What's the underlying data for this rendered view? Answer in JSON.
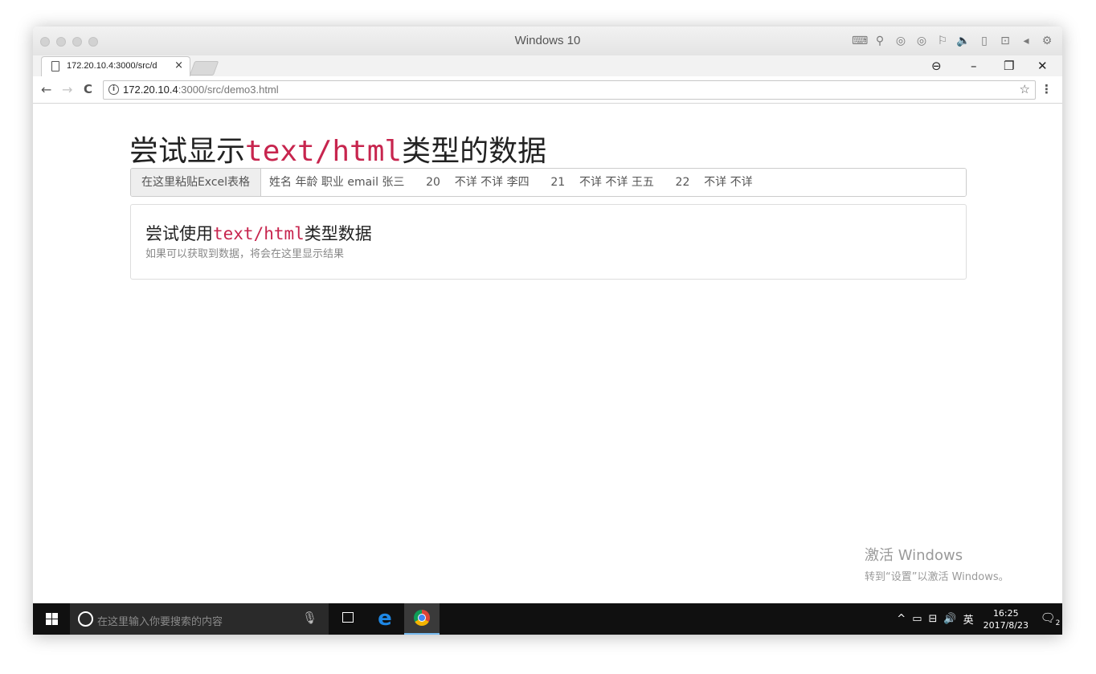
{
  "vm": {
    "title": "Windows 10",
    "tools": [
      "⌨",
      "⚲",
      "◎",
      "◎",
      "⚐",
      "🔈",
      "▯",
      "⊡",
      "◂",
      "⚙"
    ]
  },
  "browser": {
    "tab_title": "172.20.10.4:3000/src/d",
    "tab_close": "×",
    "url_host": "172.20.10.4",
    "url_path": ":3000/src/demo3.html",
    "controls": {
      "profile": "⊖",
      "minimize": "–",
      "restore": "❐",
      "close": "✕"
    },
    "nav": {
      "back": "←",
      "forward": "→",
      "reload": "C"
    },
    "info": "i",
    "star": "☆",
    "menu": "⋮"
  },
  "page": {
    "heading_prefix": "尝试显示",
    "heading_code": "text/html",
    "heading_suffix": "类型的数据",
    "paste_label": "在这里粘贴Excel表格",
    "paste_value": "姓名 年龄 职业 email 张三      20    不详 不详 李四      21    不详 不详 王五      22    不详 不详",
    "panel_title_prefix": "尝试使用",
    "panel_title_code": "text/html",
    "panel_title_suffix": "类型数据",
    "panel_subtitle": "如果可以获取到数据，将会在这里显示结果"
  },
  "watermark": {
    "line1": "激活 Windows",
    "line2": "转到“设置”以激活 Windows。"
  },
  "taskbar": {
    "search_placeholder": "在这里输入你要搜索的内容",
    "edge_glyph": "e",
    "tray_icons": [
      "^",
      "▭",
      "⊟",
      "🔊",
      "英"
    ],
    "time": "16:25",
    "date": "2017/8/23",
    "notification_glyph": "🗨",
    "notification_count": "2"
  }
}
